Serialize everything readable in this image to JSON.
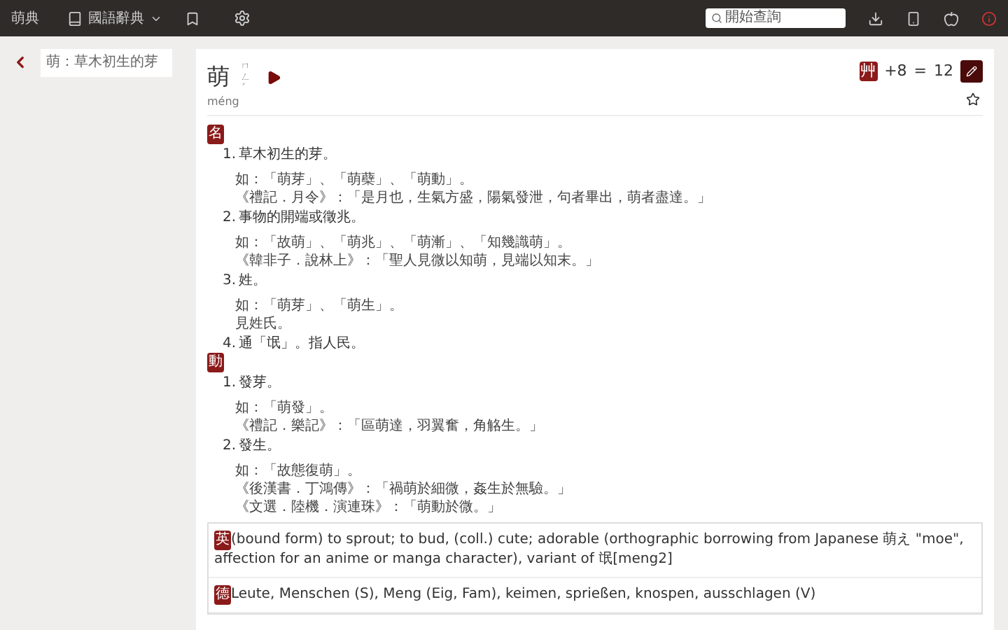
{
  "nav": {
    "logo": "萌典",
    "dictionary_menu": "國語辭典",
    "search": {
      "placeholder": "開始查詢"
    }
  },
  "sidebar": {
    "query": "萌：草木初生的芽"
  },
  "entry": {
    "title": "萌",
    "zhuyin": "ㄇㄥˊ",
    "pinyin": "méng",
    "radical": "艸",
    "strokes_added": "+8",
    "equals": "=",
    "total_strokes": "12",
    "starred": false
  },
  "groups": [
    {
      "pos": "名",
      "definitions": [
        {
          "number": "1.",
          "text": "草木初生的芽。",
          "examples": [
            "如：「萌芽」、「萌蘗」、「萌動」。",
            "《禮記．月令》：「是月也，生氣方盛，陽氣發泄，句者畢出，萌者盡達。」"
          ]
        },
        {
          "number": "2.",
          "text": "事物的開端或徵兆。",
          "examples": [
            "如：「故萌」、「萌兆」、「萌漸」、「知幾識萌」。",
            "《韓非子．說林上》：「聖人見微以知萌，見端以知末。」"
          ]
        },
        {
          "number": "3.",
          "text": "姓。",
          "examples": [
            "如：「萌芽」、「萌生」。",
            "見姓氏。"
          ]
        },
        {
          "number": "4.",
          "text": "通「氓」。指人民。"
        }
      ]
    },
    {
      "pos": "動",
      "definitions": [
        {
          "number": "1.",
          "text": "發芽。",
          "examples": [
            "如：「萌發」。",
            "《禮記．樂記》：「區萌達，羽翼奮，角觡生。」"
          ]
        },
        {
          "number": "2.",
          "text": "發生。",
          "examples": [
            "如：「故態復萌」。",
            "《後漢書．丁鴻傳》：「禍萌於細微，姦生於無驗。」",
            "《文選．陸機．演連珠》：「萌動於微。」"
          ]
        }
      ]
    }
  ],
  "translations": [
    {
      "lang": "英",
      "text": "(bound form) to sprout; to bud, (coll.) cute; adorable (orthographic borrowing from Japanese 萌え \"moe\", affection for an anime or manga character), variant of 氓[meng2]"
    },
    {
      "lang": "德",
      "text": "Leute, Menschen (S), Meng (Eig, Fam), keimen, sprießen, knospen, ausschlagen (V)"
    }
  ]
}
